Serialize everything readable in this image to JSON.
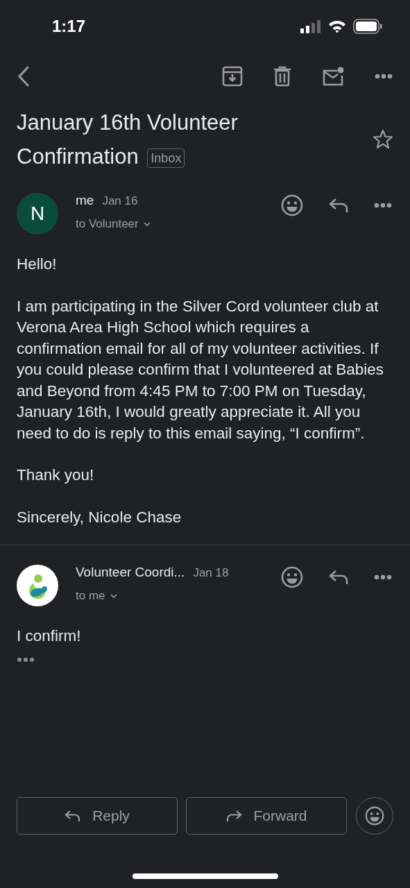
{
  "status_bar": {
    "time": "1:17"
  },
  "subject": {
    "title": "January 16th Volunteer Confirmation",
    "label": "Inbox",
    "starred": false
  },
  "messages": [
    {
      "avatar": {
        "kind": "letter",
        "letter": "N",
        "color": "#0b4d3b"
      },
      "sender": "me",
      "date": "Jan 16",
      "recipient": "to Volunteer",
      "paragraphs": [
        "Hello!",
        "I am participating in the Silver Cord volunteer club at Verona Area High School which requires a confirmation email for all of my volunteer activities. If you could please confirm that I volunteered at Babies and Beyond from 4:45 PM to 7:00 PM on Tuesday, January 16th, I would greatly appreciate it. All you need to do is reply to this email saying, “I confirm”.",
        "Thank you!",
        "Sincerely, Nicole Chase"
      ],
      "trimmed": false
    },
    {
      "avatar": {
        "kind": "logo"
      },
      "sender": "Volunteer Coordi...",
      "date": "Jan 18",
      "recipient": "to me",
      "paragraphs": [
        "I confirm!"
      ],
      "trimmed": true
    }
  ],
  "actions": [
    "Reply",
    "Forward"
  ]
}
